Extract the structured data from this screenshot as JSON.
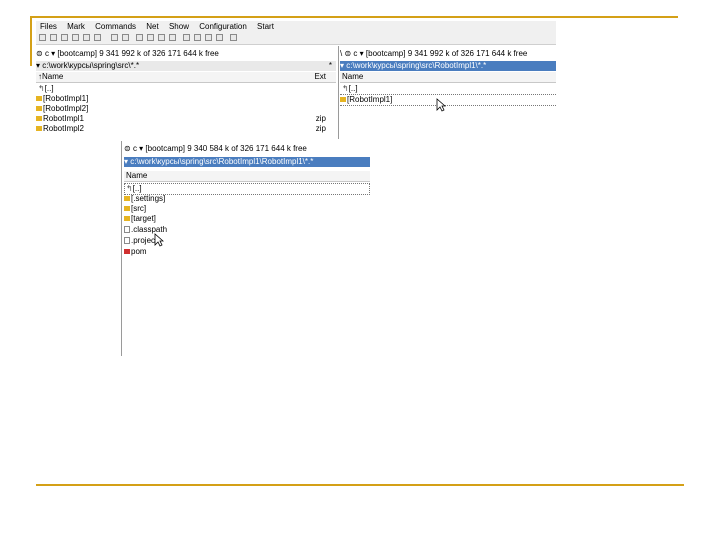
{
  "colors": {
    "slide_accent": "#d4a017",
    "active_path": "#4a7dbf"
  },
  "menu": [
    "Files",
    "Mark",
    "Commands",
    "Net",
    "Show",
    "Configuration",
    "Start"
  ],
  "left_panel": {
    "drive": "c",
    "drive_info": "[bootcamp]  9 341 992 k of 326 171 644 k free",
    "path": "c:\\work\\курсы\\spring\\src\\*.*",
    "history_btn": "*",
    "col_name": "↑Name",
    "col_ext": "Ext",
    "rows": [
      {
        "name": "[..]",
        "ext": "",
        "kind": "up"
      },
      {
        "name": "[RobotImpl1]",
        "ext": "",
        "kind": "folder"
      },
      {
        "name": "[RobotImpl2]",
        "ext": "",
        "kind": "folder"
      },
      {
        "name": "RobotImpl1",
        "ext": "zip",
        "kind": "zip"
      },
      {
        "name": "RobotImpl2",
        "ext": "zip",
        "kind": "zip"
      }
    ]
  },
  "right_panel": {
    "root_btn": "\\",
    "drive": "c",
    "drive_info": "[bootcamp]  9 341 992 k of 326 171 644 k free",
    "path": "c:\\work\\курсы\\spring\\src\\RobotImpl1\\*.*",
    "col_name": "Name",
    "rows": [
      {
        "name": "[..]",
        "kind": "up"
      },
      {
        "name": "[RobotImpl1]",
        "kind": "folder"
      }
    ]
  },
  "zoom_panel": {
    "drive": "c",
    "drive_info": "[bootcamp]  9 340 584 k of 326 171 644 k free",
    "path": "c:\\work\\курсы\\spring\\src\\RobotImpl1\\RobotImpl1\\*.*",
    "col_name": "Name",
    "rows": [
      {
        "name": "[..]",
        "kind": "up"
      },
      {
        "name": "[.settings]",
        "kind": "folder"
      },
      {
        "name": "[src]",
        "kind": "folder"
      },
      {
        "name": "[target]",
        "kind": "folder"
      },
      {
        "name": ".classpath",
        "kind": "file"
      },
      {
        "name": ".project",
        "kind": "file"
      },
      {
        "name": "pom",
        "kind": "mvn"
      }
    ]
  }
}
